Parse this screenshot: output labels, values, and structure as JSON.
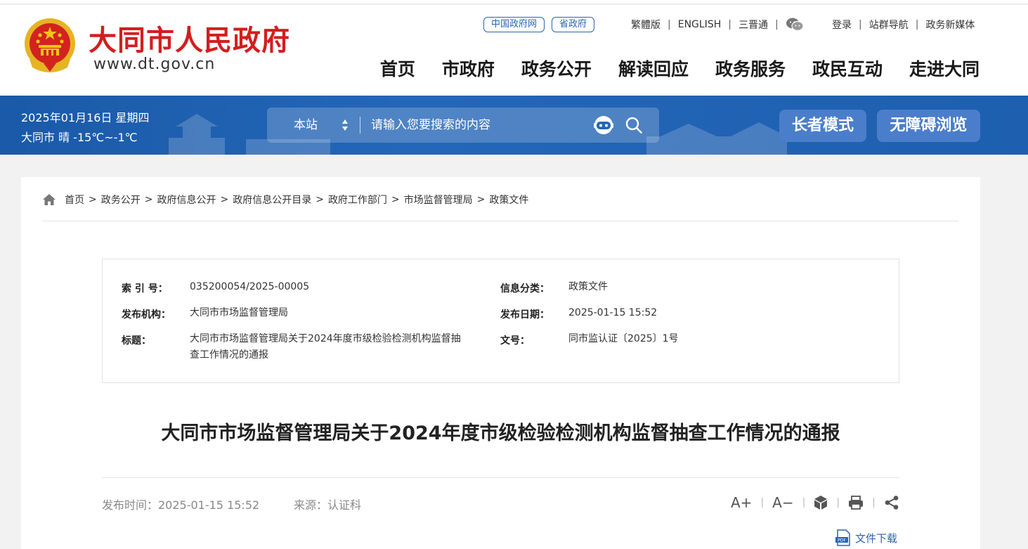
{
  "header": {
    "site_title": "大同市人民政府",
    "site_url": "www.dt.gov.cn",
    "pills": [
      "中国政府网",
      "省政府"
    ],
    "util_links": [
      "繁體版",
      "ENGLISH",
      "三晋通"
    ],
    "account_links": [
      "登录",
      "站群导航",
      "政务新媒体"
    ],
    "nav": [
      "首页",
      "市政府",
      "政务公开",
      "解读回应",
      "政务服务",
      "政民互动",
      "走进大同"
    ]
  },
  "band": {
    "date": "2025年01月16日 星期四",
    "weather": "大同市 晴 -15℃~-1℃",
    "search_scope": "本站",
    "search_placeholder": "请输入您要搜索的内容",
    "elder_mode": "长者模式",
    "accessible_mode": "无障碍浏览"
  },
  "breadcrumb": [
    "首页",
    "政务公开",
    "政府信息公开",
    "政府信息公开目录",
    "政府工作部门",
    "市场监督管理局",
    "政策文件"
  ],
  "meta": {
    "index_label": "索 引 号：",
    "index_value": "035200054/2025-00005",
    "category_label": "信息分类：",
    "category_value": "政策文件",
    "issuer_label": "发布机构：",
    "issuer_value": "大同市市场监督管理局",
    "date_label": "发布日期：",
    "date_value": "2025-01-15 15:52",
    "title_label": "标题：",
    "title_value_line1": "大同市市场监督管理局关于2024年度市级检验检测机构监督抽",
    "title_value_line2": "查工作情况的通报",
    "docno_label": "文号：",
    "docno_value": "同市监认证〔2025〕1号"
  },
  "article": {
    "title": "大同市市场监督管理局关于2024年度市级检验检测机构监督抽查工作情况的通报",
    "publish_time": "发布时间：2025-01-15 15:52",
    "source": "来源：认证科",
    "font_larger": "A+",
    "font_smaller": "A−",
    "download": "文件下载"
  },
  "colors": {
    "brand_red": "#d21e1e",
    "band_blue": "#1e5faf",
    "link_blue": "#2c64b4"
  }
}
